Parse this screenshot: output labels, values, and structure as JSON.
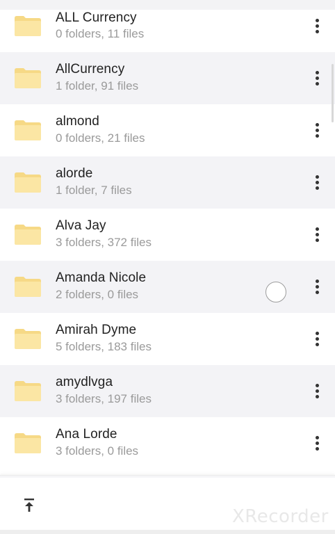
{
  "folders": [
    {
      "name": "ALL Currency",
      "meta": "0 folders, 11 files"
    },
    {
      "name": "AllCurrency",
      "meta": "1 folder, 91 files"
    },
    {
      "name": "almond",
      "meta": "0 folders, 21 files"
    },
    {
      "name": "alorde",
      "meta": "1 folder, 7 files"
    },
    {
      "name": "Alva Jay",
      "meta": "3 folders, 372 files"
    },
    {
      "name": "Amanda Nicole",
      "meta": "2 folders, 0 files"
    },
    {
      "name": "Amirah Dyme",
      "meta": "5 folders, 183 files"
    },
    {
      "name": "amydlvga",
      "meta": "3 folders, 197 files"
    },
    {
      "name": "Ana Lorde",
      "meta": "3 folders, 0 files"
    }
  ],
  "watermark": "XRecorder",
  "icons": {
    "folder": "folder-icon",
    "more": "more-vertical-icon",
    "upload": "upload-to-top-icon"
  },
  "colors": {
    "folder_fill": "#fbe6a4",
    "folder_tab": "#f6d986",
    "alt_row": "#f3f3f6"
  }
}
